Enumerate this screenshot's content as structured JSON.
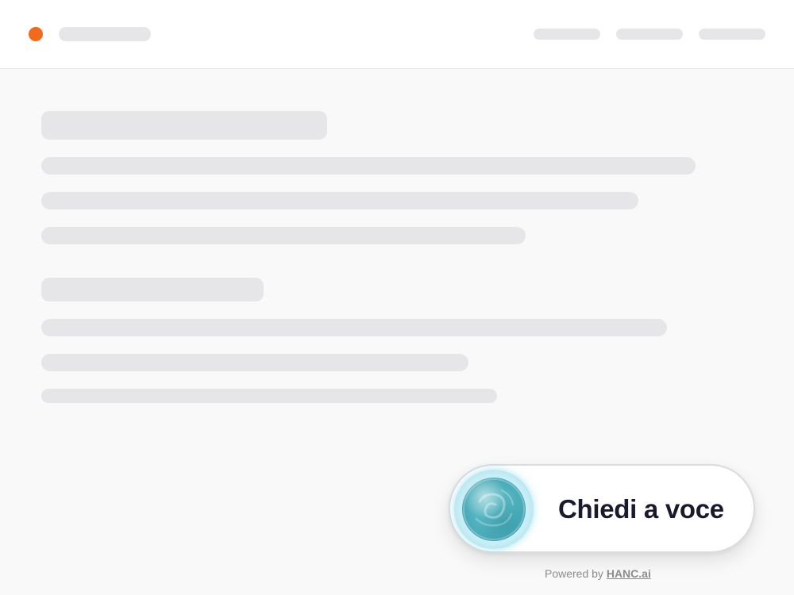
{
  "header": {
    "logo_color": "#f26a1b",
    "skeleton_nav_items": 3
  },
  "colors": {
    "skeleton": "#e6e6e8",
    "background": "#f9f9f9",
    "orb": "#4fb0bd",
    "label": "#1a1a2e"
  },
  "voice_widget": {
    "label": "Chiedi a voce",
    "icon": "voice-orb-icon"
  },
  "footer": {
    "powered_prefix": "Powered by",
    "powered_link": "HANC.ai"
  }
}
